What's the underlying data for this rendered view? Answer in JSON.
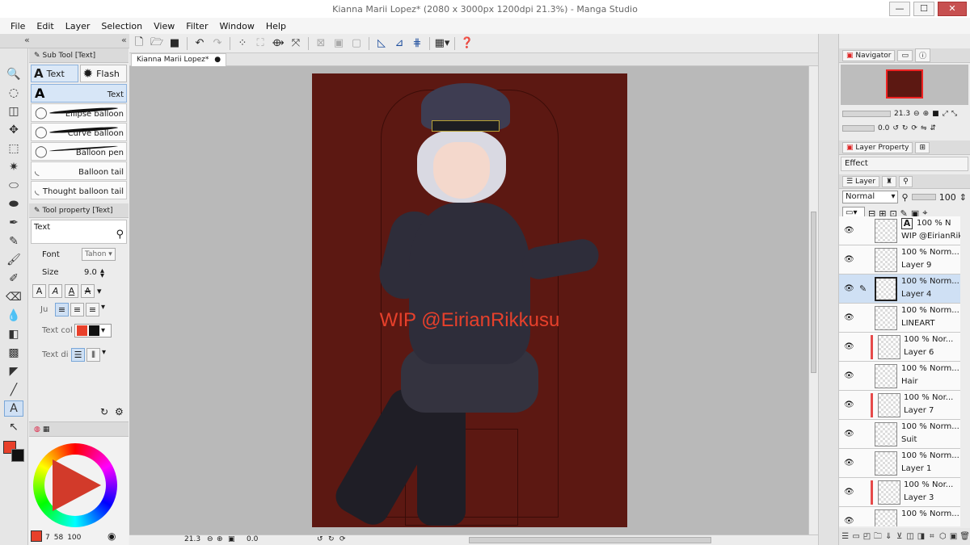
{
  "window": {
    "title": "Kianna Marii Lopez* (2080 x 3000px 1200dpi 21.3%)  - Manga Studio",
    "minimize": "—",
    "maximize": "☐",
    "close": "✕"
  },
  "menu": [
    "File",
    "Edit",
    "Layer",
    "Selection",
    "View",
    "Filter",
    "Window",
    "Help"
  ],
  "subtool": {
    "header": "Sub Tool [Text]",
    "tabs": [
      {
        "label": "Text",
        "glyph": "A"
      },
      {
        "label": "Flash",
        "glyph": "✹"
      }
    ],
    "items": [
      {
        "label": "Text",
        "active": true
      },
      {
        "label": "Ellipse balloon"
      },
      {
        "label": "Curve balloon"
      },
      {
        "label": "Balloon pen"
      },
      {
        "label": "Balloon tail"
      },
      {
        "label": "Thought balloon tail"
      }
    ]
  },
  "toolprop": {
    "header": "Tool property [Text]",
    "name": "Text",
    "font_label": "Font",
    "font_value": "Tahon",
    "size_label": "Size",
    "size_value": "9.0",
    "justify_label": "Ju",
    "textcolor_label": "Text col",
    "textdir_label": "Text di"
  },
  "colors": {
    "main": "#e8402a",
    "sub": "#111111",
    "bottom_values": [
      "7",
      "58",
      "100"
    ]
  },
  "document": {
    "tab": "Kianna Marii Lopez*",
    "tab_close": "●",
    "watermark": "WIP @EirianRikkusu",
    "zoom": "21.3",
    "angle": "0.0"
  },
  "navigator": {
    "tab": "Navigator",
    "zoom": "21.3",
    "angle": "0.0"
  },
  "layerprop": {
    "tab": "Layer Property",
    "effect_label": "Effect"
  },
  "layerpanel": {
    "tab": "Layer",
    "blend": "Normal",
    "opacity": "100",
    "layers": [
      {
        "pct": "100 %",
        "mode": "N",
        "name": "WIP @EirianRik",
        "selected": false,
        "marked": false,
        "pen": false,
        "text": true
      },
      {
        "pct": "100 %",
        "mode": "Norm...",
        "name": "Layer 9",
        "selected": false,
        "marked": false,
        "pen": false
      },
      {
        "pct": "100 %",
        "mode": "Norm...",
        "name": "Layer 4",
        "selected": true,
        "marked": false,
        "pen": true
      },
      {
        "pct": "100 %",
        "mode": "Norm...",
        "name": "LINEART",
        "selected": false,
        "marked": false,
        "pen": false
      },
      {
        "pct": "100 %",
        "mode": "Nor...",
        "name": "Layer 6",
        "selected": false,
        "marked": true,
        "pen": false
      },
      {
        "pct": "100 %",
        "mode": "Norm...",
        "name": "Hair",
        "selected": false,
        "marked": false,
        "pen": false
      },
      {
        "pct": "100 %",
        "mode": "Nor...",
        "name": "Layer 7",
        "selected": false,
        "marked": true,
        "pen": false
      },
      {
        "pct": "100 %",
        "mode": "Norm...",
        "name": "Suit",
        "selected": false,
        "marked": false,
        "pen": false
      },
      {
        "pct": "100 %",
        "mode": "Norm...",
        "name": "Layer 1",
        "selected": false,
        "marked": false,
        "pen": false
      },
      {
        "pct": "100 %",
        "mode": "Nor...",
        "name": "Layer 3",
        "selected": false,
        "marked": true,
        "pen": false
      },
      {
        "pct": "100 %",
        "mode": "Norm...",
        "name": "",
        "selected": false,
        "marked": false,
        "pen": false
      }
    ]
  },
  "icons": {
    "eye": "eye-icon",
    "pen": "pen-icon"
  }
}
